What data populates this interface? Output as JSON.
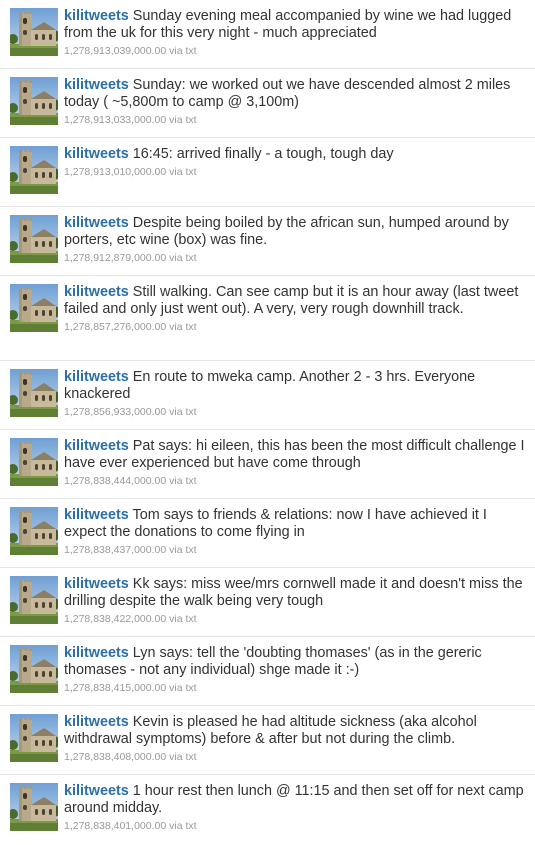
{
  "tweets": [
    {
      "user": "kilitweets",
      "text": "Sunday evening meal accompanied by wine we had lugged from the uk for this very night - much appreciated",
      "timestamp": "1,278,913,039,000.00",
      "via": "via txt"
    },
    {
      "user": "kilitweets",
      "text": "Sunday: we worked out we have descended almost 2 miles today ( ~5,800m to camp @ 3,100m)",
      "timestamp": "1,278,913,033,000.00",
      "via": "via txt"
    },
    {
      "user": "kilitweets",
      "text": "16:45: arrived finally - a tough, tough day",
      "timestamp": "1,278,913,010,000.00",
      "via": "via txt"
    },
    {
      "user": "kilitweets",
      "text": "Despite being boiled by the african sun, humped around by porters, etc wine (box) was fine.",
      "timestamp": "1,278,912,879,000.00",
      "via": "via txt"
    },
    {
      "user": "kilitweets",
      "text": "Still walking. Can see camp but it is an hour away (last tweet failed and only just went out). A very, very rough downhill track.",
      "timestamp": "1,278,857,276,000.00",
      "via": "via txt"
    },
    {
      "user": "kilitweets",
      "text": "En route to mweka camp. Another 2 - 3 hrs. Everyone knackered",
      "timestamp": "1,278,856,933,000.00",
      "via": "via txt"
    },
    {
      "user": "kilitweets",
      "text": "Pat says: hi eileen, this has been the most difficult challenge I have ever experienced but have come through",
      "timestamp": "1,278,838,444,000.00",
      "via": "via txt"
    },
    {
      "user": "kilitweets",
      "text": "Tom says to friends & relations: now I have achieved it I expect the donations to come flying in",
      "timestamp": "1,278,838,437,000.00",
      "via": "via txt"
    },
    {
      "user": "kilitweets",
      "text": "Kk says: miss wee/mrs cornwell made it and doesn't miss the drilling despite the walk being very tough",
      "timestamp": "1,278,838,422,000.00",
      "via": "via txt"
    },
    {
      "user": "kilitweets",
      "text": "Lyn says: tell the 'doubting thomases' (as in the gereric thomases - not any individual) shge made it :-)",
      "timestamp": "1,278,838,415,000.00",
      "via": "via txt"
    },
    {
      "user": "kilitweets",
      "text": "Kevin is pleased he had altitude sickness (aka alcohol withdrawal symptoms) before & after but not during the climb.",
      "timestamp": "1,278,838,408,000.00",
      "via": "via txt"
    },
    {
      "user": "kilitweets",
      "text": "1 hour rest then lunch @ 11:15 and then set off for next camp around midday.",
      "timestamp": "1,278,838,401,000.00",
      "via": "via txt"
    }
  ],
  "colors": {
    "username": "#2c6fa8",
    "text": "#333333",
    "meta": "#999999",
    "divider": "#e6e6e6"
  },
  "avatar_icon": "church-photo-avatar"
}
